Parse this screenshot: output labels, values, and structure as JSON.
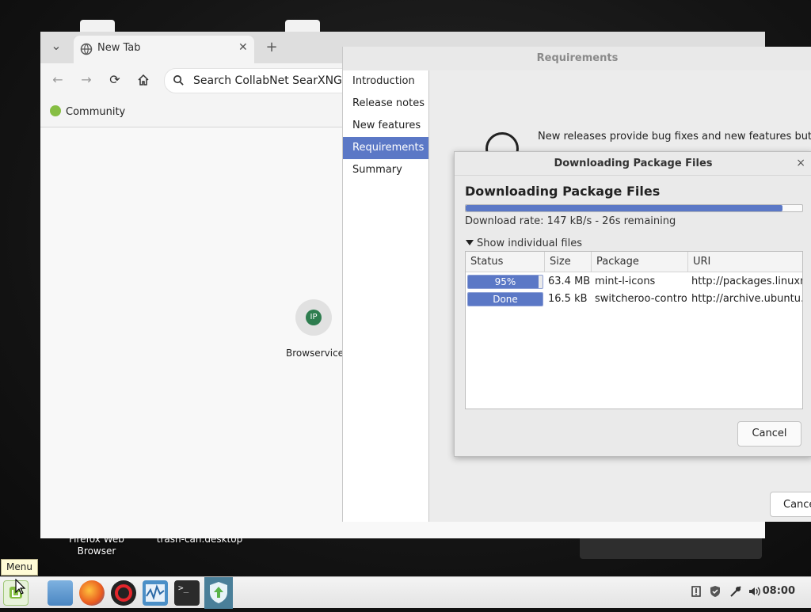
{
  "desktop": {
    "icons": [
      {
        "label": "Firefox Web\nBrowser"
      },
      {
        "label": "trash-can.desktop"
      }
    ]
  },
  "browser": {
    "tab_title": "New Tab",
    "new_tab_symbol": "+",
    "tab_list_symbol": "⌄",
    "omnibox_text": "Search CollabNet SearXNG or t",
    "bookmark": "Community",
    "shortcut_initials": "IP",
    "shortcut_label": "Browservice"
  },
  "requirements": {
    "title": "Requirements",
    "nav": [
      "Introduction",
      "Release notes",
      "New features",
      "Requirements",
      "Summary"
    ],
    "active_index": 3,
    "message": "New releases provide bug fixes and new features but they introduce new issues. Upgrading always represents a risk",
    "cancel_label": "Cance"
  },
  "download_dialog": {
    "title": "Downloading Package Files",
    "heading": "Downloading Package Files",
    "overall_progress_pct": 94,
    "rate_text": "Download rate: 147 kB/s - 26s remaining",
    "expander_label": "Show individual files",
    "columns": [
      "Status",
      "Size",
      "Package",
      "URI"
    ],
    "rows": [
      {
        "status": "95%",
        "progress_pct": 95,
        "size": "63.4 MB",
        "package": "mint-l-icons",
        "uri": "http://packages.linuxmint.com"
      },
      {
        "status": "Done",
        "progress_pct": 100,
        "size": "16.5 kB",
        "package": "switcheroo-control",
        "uri": "http://archive.ubuntu.com"
      }
    ],
    "cancel_label": "Cancel",
    "close_symbol": "×"
  },
  "tooltip": "Menu",
  "taskbar": {
    "clock": "08:00",
    "apps": [
      "menu-icon",
      "files-icon",
      "firefox-icon",
      "opera-icon",
      "system-monitor-icon",
      "terminal-icon",
      "update-manager-icon"
    ]
  },
  "colors": {
    "accent": "#5b78c6"
  }
}
